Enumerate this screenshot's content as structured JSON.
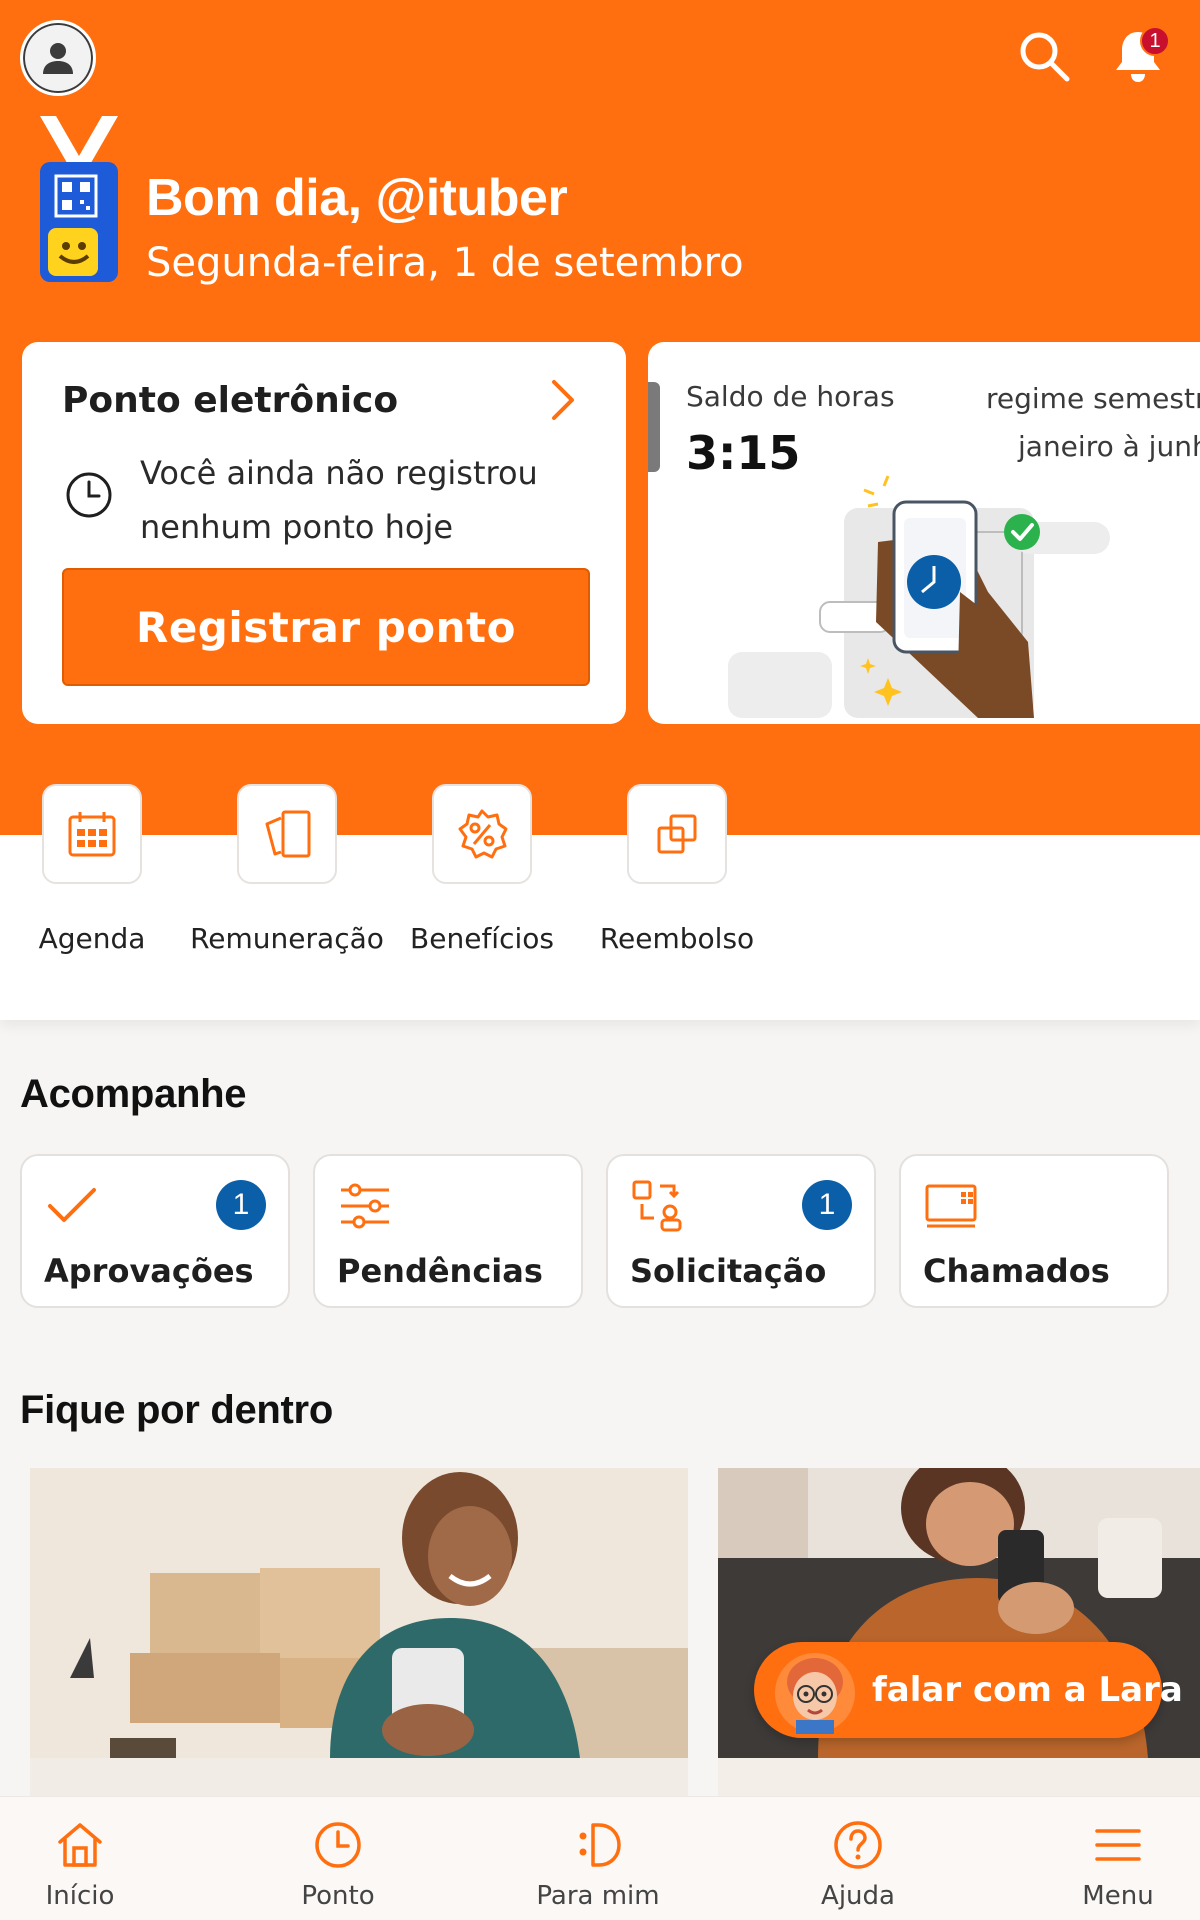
{
  "colors": {
    "brand": "#ff6f0f",
    "badge_red": "#c8102e",
    "count_blue": "#0a5fa8"
  },
  "header": {
    "notification_count": "1",
    "greeting": "Bom dia, @ituber",
    "date": "Segunda-feira, 1 de setembro"
  },
  "ponto_card": {
    "title": "Ponto eletrônico",
    "message": "Você ainda não registrou nenhum ponto hoje",
    "button_label": "Registrar ponto"
  },
  "saldo_card": {
    "label": "Saldo de horas",
    "value": "3:15",
    "regime": "regime semestra",
    "period": "janeiro à junh"
  },
  "shortcuts": [
    {
      "label": "Agenda",
      "icon": "calendar-icon"
    },
    {
      "label": "Remuneração",
      "icon": "payslip-icon"
    },
    {
      "label": "Benefícios",
      "icon": "discount-badge-icon"
    },
    {
      "label": "Reembolso",
      "icon": "refund-icon"
    }
  ],
  "acompanhe": {
    "title": "Acompanhe",
    "items": [
      {
        "label": "Aprovações",
        "count": "1",
        "icon": "check-icon"
      },
      {
        "label": "Pendências",
        "icon": "sliders-icon"
      },
      {
        "label": "Solicitação",
        "count": "1",
        "icon": "request-icon"
      },
      {
        "label": "Chamados",
        "icon": "ticket-icon"
      }
    ]
  },
  "fique_por_dentro": {
    "title": "Fique por dentro",
    "lara_button": "falar com a Lara"
  },
  "bottom_nav": [
    {
      "label": "Início",
      "icon": "home-icon"
    },
    {
      "label": "Ponto",
      "icon": "clock-icon"
    },
    {
      "label": "Para mim",
      "icon": "for-me-icon"
    },
    {
      "label": "Ajuda",
      "icon": "help-icon"
    },
    {
      "label": "Menu",
      "icon": "menu-icon"
    }
  ]
}
